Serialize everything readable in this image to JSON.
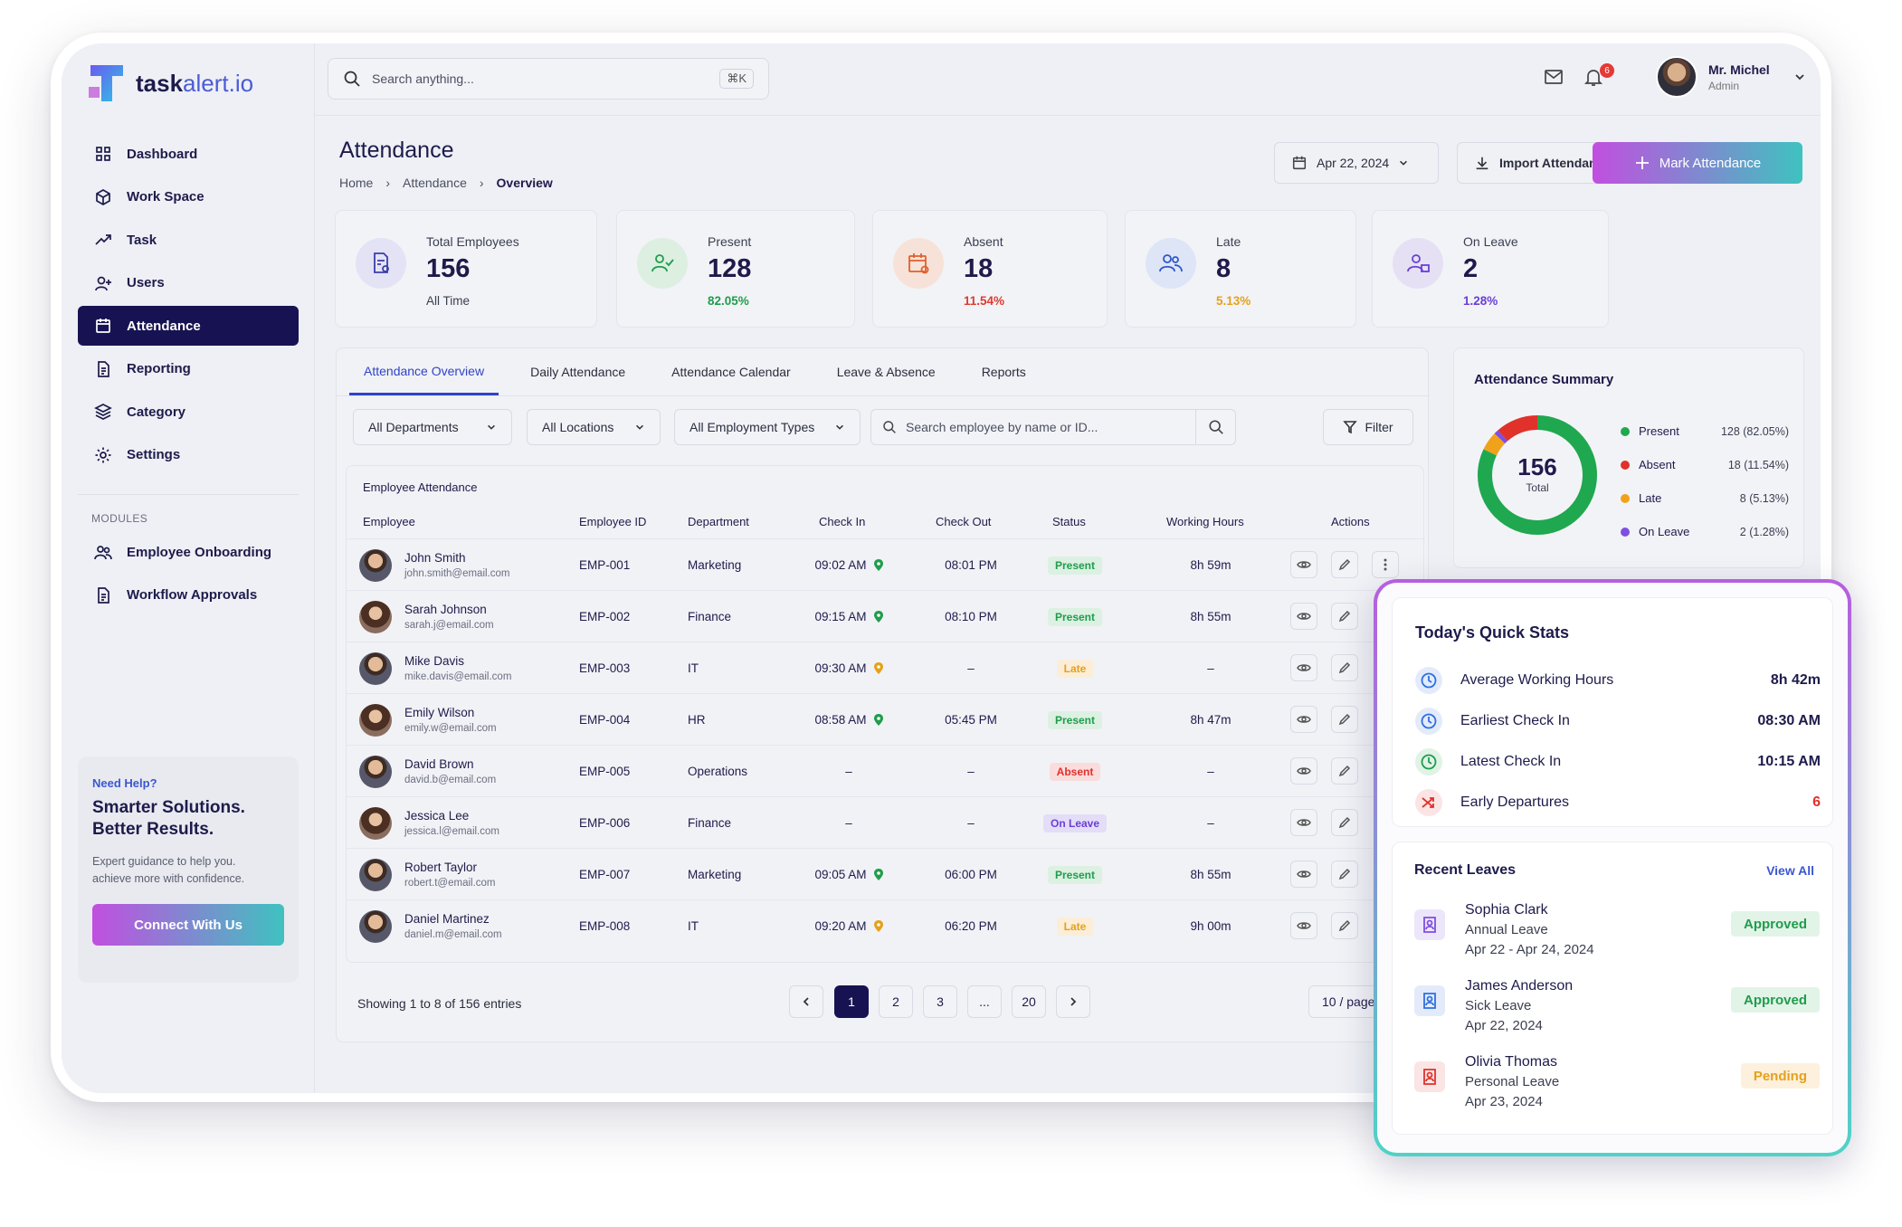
{
  "brand": {
    "name_bold": "task",
    "name_light": "alert.io"
  },
  "topbar": {
    "search_placeholder": "Search anything...",
    "shortcut": "⌘K",
    "notif_count": "6",
    "user_name": "Mr. Michel",
    "user_role": "Admin"
  },
  "sidebar": {
    "items": [
      {
        "label": "Dashboard",
        "icon": "grid-icon"
      },
      {
        "label": "Work Space",
        "icon": "cube-icon"
      },
      {
        "label": "Task",
        "icon": "trend-icon"
      },
      {
        "label": "Users",
        "icon": "user-plus-icon"
      },
      {
        "label": "Attendance",
        "icon": "calendar-icon",
        "active": true
      },
      {
        "label": "Reporting",
        "icon": "document-icon"
      },
      {
        "label": "Category",
        "icon": "layers-icon"
      },
      {
        "label": "Settings",
        "icon": "gear-icon"
      }
    ],
    "modules_label": "MODULES",
    "modules": [
      {
        "label": "Employee Onboarding",
        "icon": "users-icon"
      },
      {
        "label": "Workflow Approvals",
        "icon": "document-icon"
      }
    ],
    "help": {
      "kicker": "Need Help?",
      "title_1": "Smarter Solutions.",
      "title_2": "Better Results.",
      "desc_1": "Expert guidance to help you.",
      "desc_2": "achieve more with confidence.",
      "button": "Connect With Us"
    }
  },
  "header": {
    "title": "Attendance",
    "breadcrumb": [
      "Home",
      "Attendance",
      "Overview"
    ],
    "date": "Apr 22, 2024",
    "import_label": "Import Attendance",
    "mark_label": "Mark Attendance"
  },
  "stats": [
    {
      "label": "Total Employees",
      "value": "156",
      "sub": "All Time",
      "color": "#1e1b4b"
    },
    {
      "label": "Present",
      "value": "128",
      "sub": "82.05%",
      "color": "#1f9d4c"
    },
    {
      "label": "Absent",
      "value": "18",
      "sub": "11.54%",
      "color": "#e03a2f"
    },
    {
      "label": "Late",
      "value": "8",
      "sub": "5.13%",
      "color": "#e5a11a"
    },
    {
      "label": "On Leave",
      "value": "2",
      "sub": "1.28%",
      "color": "#6a3fd6"
    }
  ],
  "tabs": [
    "Attendance Overview",
    "Daily Attendance",
    "Attendance Calendar",
    "Leave & Absence",
    "Reports"
  ],
  "filters": {
    "departments": "All Departments",
    "locations": "All Locations",
    "types": "All Employment Types",
    "search_placeholder": "Search employee by name or ID...",
    "filter_label": "Filter"
  },
  "table": {
    "caption": "Employee Attendance",
    "headers": [
      "Employee",
      "Employee ID",
      "Department",
      "Check In",
      "Check Out",
      "Status",
      "Working Hours",
      "Actions"
    ],
    "rows": [
      {
        "name": "John Smith",
        "email": "john.smith@email.com",
        "id": "EMP-001",
        "dept": "Marketing",
        "in": "09:02 AM",
        "out": "08:01 PM",
        "status": "Present",
        "hours": "8h 59m",
        "pin": "green",
        "g": "m"
      },
      {
        "name": "Sarah Johnson",
        "email": "sarah.j@email.com",
        "id": "EMP-002",
        "dept": "Finance",
        "in": "09:15 AM",
        "out": "08:10 PM",
        "status": "Present",
        "hours": "8h 55m",
        "pin": "green",
        "g": "f"
      },
      {
        "name": "Mike Davis",
        "email": "mike.davis@email.com",
        "id": "EMP-003",
        "dept": "IT",
        "in": "09:30 AM",
        "out": "–",
        "status": "Late",
        "hours": "–",
        "pin": "orange",
        "g": "m"
      },
      {
        "name": "Emily Wilson",
        "email": "emily.w@email.com",
        "id": "EMP-004",
        "dept": "HR",
        "in": "08:58 AM",
        "out": "05:45 PM",
        "status": "Present",
        "hours": "8h 47m",
        "pin": "green",
        "g": "f"
      },
      {
        "name": "David Brown",
        "email": "david.b@email.com",
        "id": "EMP-005",
        "dept": "Operations",
        "in": "–",
        "out": "–",
        "status": "Absent",
        "hours": "–",
        "pin": "",
        "g": "m"
      },
      {
        "name": "Jessica Lee",
        "email": "jessica.l@email.com",
        "id": "EMP-006",
        "dept": "Finance",
        "in": "–",
        "out": "–",
        "status": "On Leave",
        "hours": "–",
        "pin": "",
        "g": "f"
      },
      {
        "name": "Robert Taylor",
        "email": "robert.t@email.com",
        "id": "EMP-007",
        "dept": "Marketing",
        "in": "09:05 AM",
        "out": "06:00 PM",
        "status": "Present",
        "hours": "8h 55m",
        "pin": "green",
        "g": "m"
      },
      {
        "name": "Daniel Martinez",
        "email": "daniel.m@email.com",
        "id": "EMP-008",
        "dept": "IT",
        "in": "09:20 AM",
        "out": "06:20 PM",
        "status": "Late",
        "hours": "9h 00m",
        "pin": "orange",
        "g": "m"
      }
    ]
  },
  "pagination": {
    "showing": "Showing 1 to 8 of 156 entries",
    "pages": [
      "1",
      "2",
      "3",
      "...",
      "20"
    ],
    "per_page": "10 / page"
  },
  "summary": {
    "title": "Attendance Summary",
    "total": "156",
    "total_label": "Total",
    "legend": [
      {
        "label": "Present",
        "value": "128 (82.05%)",
        "color": "#1fa84f",
        "share": 0.8205
      },
      {
        "label": "Absent",
        "value": "18 (11.54%)",
        "color": "#e0312b",
        "share": 0.1154
      },
      {
        "label": "Late",
        "value": "8 (5.13%)",
        "color": "#f0a21b",
        "share": 0.0513
      },
      {
        "label": "On Leave",
        "value": "2 (1.28%)",
        "color": "#7e4fe0",
        "share": 0.0128
      }
    ]
  },
  "quick_stats": {
    "title": "Today's Quick Stats",
    "items": [
      {
        "label": "Average Working Hours",
        "value": "8h 42m",
        "icon": "clock-icon"
      },
      {
        "label": "Earliest Check In",
        "value": "08:30 AM",
        "icon": "clock-icon"
      },
      {
        "label": "Latest Check In",
        "value": "10:15 AM",
        "icon": "clock-icon"
      },
      {
        "label": "Early Departures",
        "value": "6",
        "icon": "shuffle-icon"
      }
    ]
  },
  "recent_leaves": {
    "title": "Recent Leaves",
    "view_all": "View All",
    "items": [
      {
        "name": "Sophia Clark",
        "type": "Annual Leave",
        "date": "Apr 22 - Apr 24, 2024",
        "status": "Approved"
      },
      {
        "name": "James Anderson",
        "type": "Sick Leave",
        "date": "Apr 22, 2024",
        "status": "Approved"
      },
      {
        "name": "Olivia Thomas",
        "type": "Personal Leave",
        "date": "Apr 23, 2024",
        "status": "Pending"
      }
    ]
  }
}
